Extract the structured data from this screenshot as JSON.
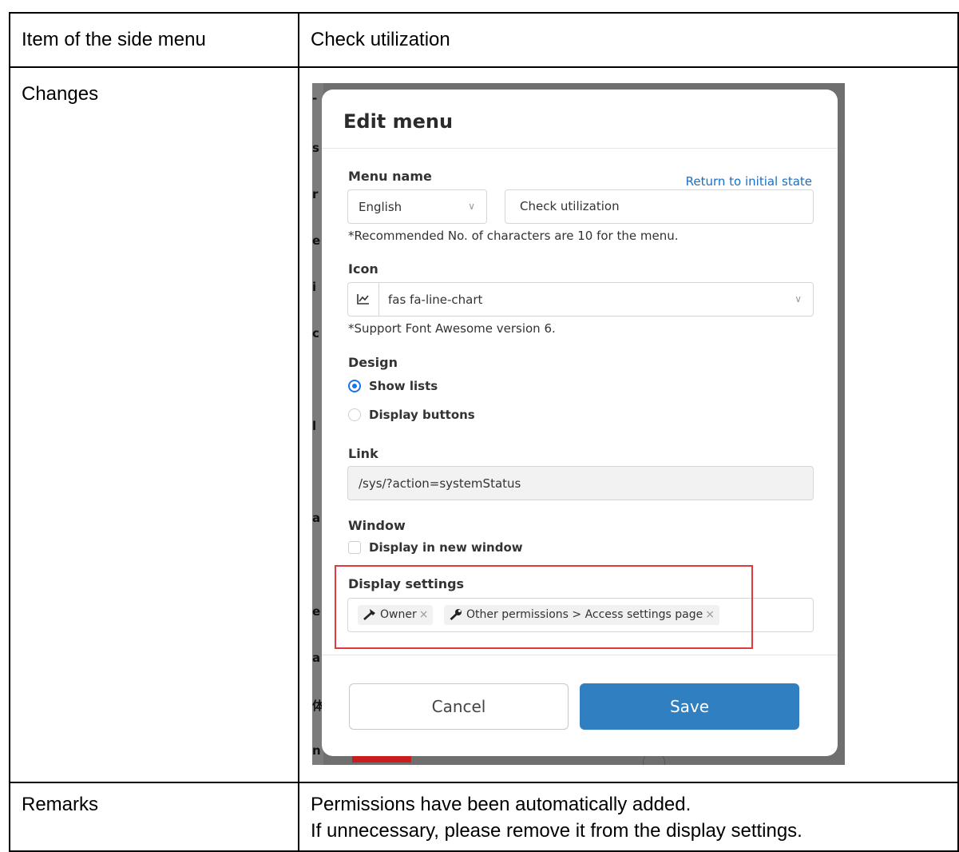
{
  "doc": {
    "row1": {
      "label": "Item of the side menu",
      "value": "Check utilization"
    },
    "row2": {
      "label": "Changes"
    },
    "row3": {
      "label": "Remarks",
      "line1": "Permissions have been automatically added.",
      "line2": "If unnecessary, please remove it from the display settings."
    }
  },
  "modal": {
    "title": "Edit menu",
    "menu_name": {
      "label": "Menu name",
      "reset_link": "Return to initial state",
      "language": "English",
      "value": "Check utilization",
      "hint": "*Recommended No. of characters are 10 for the menu."
    },
    "icon": {
      "label": "Icon",
      "icon_name": "line-chart-icon",
      "value": "fas fa-line-chart",
      "hint": "*Support Font Awesome version 6."
    },
    "design": {
      "label": "Design",
      "options": [
        {
          "label": "Show lists",
          "selected": true
        },
        {
          "label": "Display buttons",
          "selected": false
        }
      ]
    },
    "link": {
      "label": "Link",
      "value": "/sys/?action=systemStatus"
    },
    "window": {
      "label": "Window",
      "option": "Display in new window",
      "checked": false
    },
    "display_settings": {
      "label": "Display settings",
      "tags": [
        {
          "icon": "hammer-icon",
          "label": "Owner",
          "remove": "×"
        },
        {
          "icon": "wrench-icon",
          "label": "Other permissions > Access settings page",
          "remove": "×"
        }
      ]
    },
    "buttons": {
      "cancel": "Cancel",
      "save": "Save"
    }
  },
  "colors": {
    "highlight": "#e0393e",
    "primary": "#2f7fc1",
    "link": "#1a6fc4"
  }
}
